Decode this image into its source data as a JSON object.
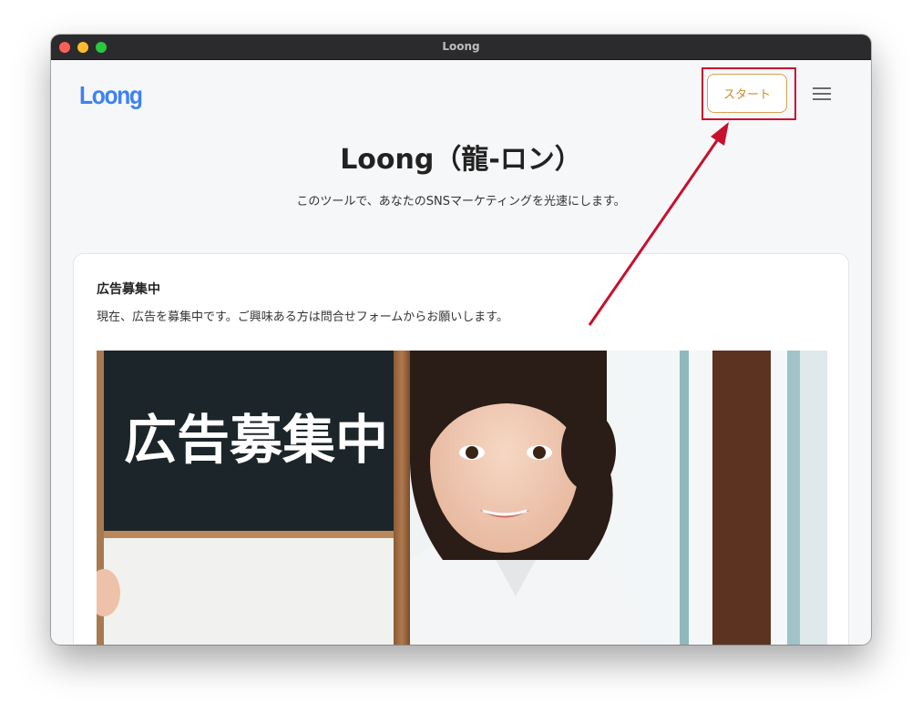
{
  "window": {
    "title": "Loong"
  },
  "header": {
    "logo": "Loong",
    "start_button": "スタート",
    "menu_icon": "hamburger-menu-icon"
  },
  "hero": {
    "title": "Loong（龍-ロン）",
    "subtitle": "このツールで、あなたのSNSマーケティングを光速にします。"
  },
  "ad_card": {
    "title": "広告募集中",
    "text": "現在、広告を募集中です。ご興味ある方は問合せフォームからお願いします。",
    "image_text": "広告募集中"
  },
  "colors": {
    "accent": "#3e82f0",
    "button_border": "#d9a24e",
    "highlight": "#c8102e"
  }
}
